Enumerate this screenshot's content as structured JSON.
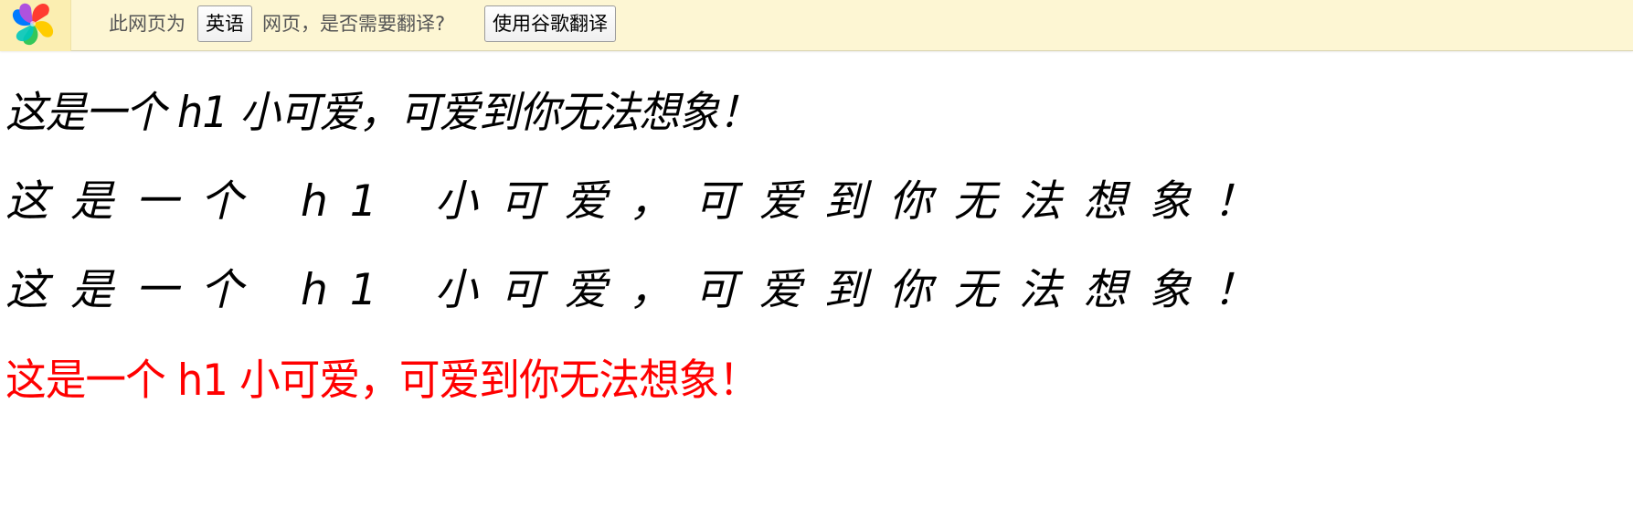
{
  "translate_bar": {
    "prefix_text": "此网页为",
    "language_button": "英语",
    "question_text": "网页，是否需要翻译?",
    "translate_button": "使用谷歌翻译"
  },
  "headings": [
    {
      "text": "这是一个 h1 小可爱，可爱到你无法想象！"
    },
    {
      "text": "这是一个 h1 小可爱，可爱到你无法想象！"
    },
    {
      "text": "这是一个 h1 小可爱，可爱到你无法想象！"
    },
    {
      "text": "这是一个 h1 小可爱，可爱到你无法想象！"
    }
  ],
  "colors": {
    "bar_background": "#fdf6d3",
    "logo_cell_background": "#fbeeb1",
    "red_heading": "#ff0000"
  },
  "icons": {
    "logo": "browser-pinwheel-logo-icon"
  }
}
